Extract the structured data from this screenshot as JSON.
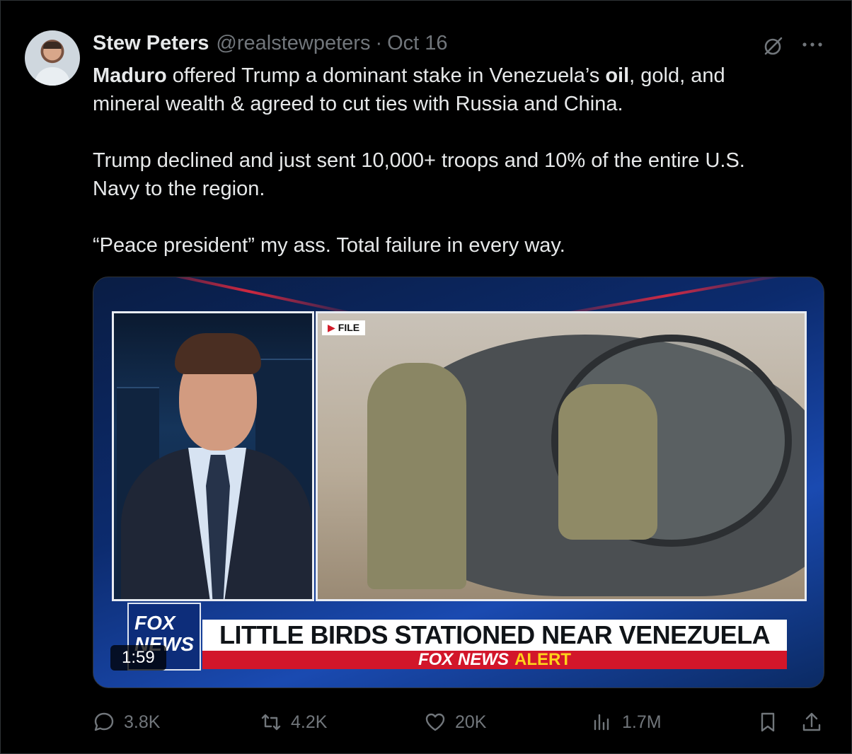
{
  "author": {
    "display_name": "Stew Peters",
    "handle": "@realstewpeters",
    "separator": "·",
    "date": "Oct 16"
  },
  "tweet": {
    "line1_bold1": "Maduro",
    "line1_a": " offered Trump a dominant stake in Venezuela’s ",
    "line1_bold2": "oil",
    "line1_b": ", gold, and\nmineral wealth & agreed to cut ties with Russia and China.\n\nTrump declined and just sent 10,000+ troops and 10% of the entire U.S.\nNavy to the region.\n\n“Peace president” my ass. Total failure in every way."
  },
  "media": {
    "file_tag": "FILE",
    "fox_logo": "FOX NEWS",
    "headline": "LITTLE BIRDS STATIONED NEAR VENEZUELA",
    "alert_fox": "FOX NEWS",
    "alert_word": "ALERT",
    "duration": "1:59"
  },
  "actions": {
    "replies": "3.8K",
    "reposts": "4.2K",
    "likes": "20K",
    "views": "1.7M"
  },
  "icons": [
    "grok-icon",
    "more-icon",
    "reply-icon",
    "repost-icon",
    "like-icon",
    "views-icon",
    "bookmark-icon",
    "share-icon"
  ],
  "colors": {
    "background": "#000000",
    "text": "#e7e9ea",
    "muted": "#71767b",
    "fox_red": "#d2162a",
    "fox_yellow": "#ffd21a"
  }
}
